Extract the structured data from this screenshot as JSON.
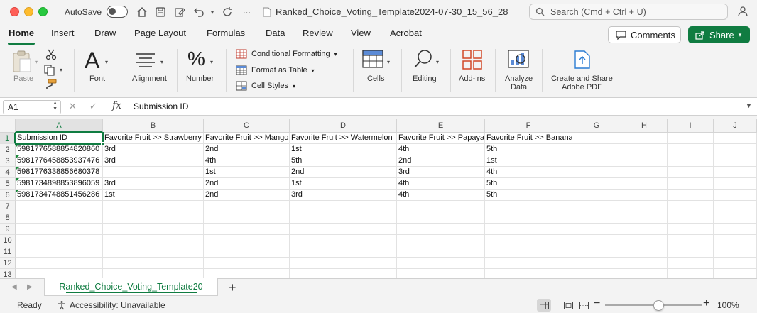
{
  "titlebar": {
    "autosave_label": "AutoSave",
    "doc_title": "Ranked_Choice_Voting_Template2024-07-30_15_56_28",
    "search_placeholder": "Search (Cmd + Ctrl + U)"
  },
  "ribbon_tabs": [
    "Home",
    "Insert",
    "Draw",
    "Page Layout",
    "Formulas",
    "Data",
    "Review",
    "View",
    "Acrobat"
  ],
  "active_tab": "Home",
  "buttons": {
    "comments": "Comments",
    "share": "Share"
  },
  "ribbon": {
    "paste": "Paste",
    "font": "Font",
    "alignment": "Alignment",
    "number": "Number",
    "conditional_formatting": "Conditional Formatting",
    "format_as_table": "Format as Table",
    "cell_styles": "Cell Styles",
    "cells": "Cells",
    "editing": "Editing",
    "addins": "Add-ins",
    "analyze_data_1": "Analyze",
    "analyze_data_2": "Data",
    "create_share_1": "Create and Share",
    "create_share_2": "Adobe PDF"
  },
  "formula_bar": {
    "name_box": "A1",
    "fx": "fx",
    "content": "Submission ID"
  },
  "grid": {
    "columns": [
      "A",
      "B",
      "C",
      "D",
      "E",
      "F",
      "G",
      "H",
      "I",
      "J"
    ],
    "rows": [
      "1",
      "2",
      "3",
      "4",
      "5",
      "6",
      "7",
      "8",
      "9",
      "10",
      "11",
      "12",
      "13"
    ],
    "headers": [
      "Submission ID",
      "Favorite Fruit >> Strawberry",
      "Favorite Fruit >> Mango",
      "Favorite Fruit >> Watermelon",
      "Favorite Fruit >> Papaya",
      "Favorite Fruit >> Banana"
    ],
    "data": [
      [
        "5981776588854820860",
        "3rd",
        "2nd",
        "1st",
        "4th",
        "5th"
      ],
      [
        "5981776458853937476",
        "3rd",
        "4th",
        "5th",
        "2nd",
        "1st"
      ],
      [
        "5981776338856680378",
        "",
        "1st",
        "2nd",
        "3rd",
        "4th"
      ],
      [
        "5981734898853896059",
        "3rd",
        "2nd",
        "1st",
        "4th",
        "5th"
      ],
      [
        "5981734748851456286",
        "1st",
        "2nd",
        "3rd",
        "4th",
        "5th"
      ]
    ]
  },
  "sheet_tab": "Ranked_Choice_Voting_Template20",
  "status": {
    "ready": "Ready",
    "accessibility": "Accessibility: Unavailable",
    "zoom": "100%"
  },
  "colors": {
    "accent": "#107c41",
    "grid_line": "#e2e2e2"
  }
}
